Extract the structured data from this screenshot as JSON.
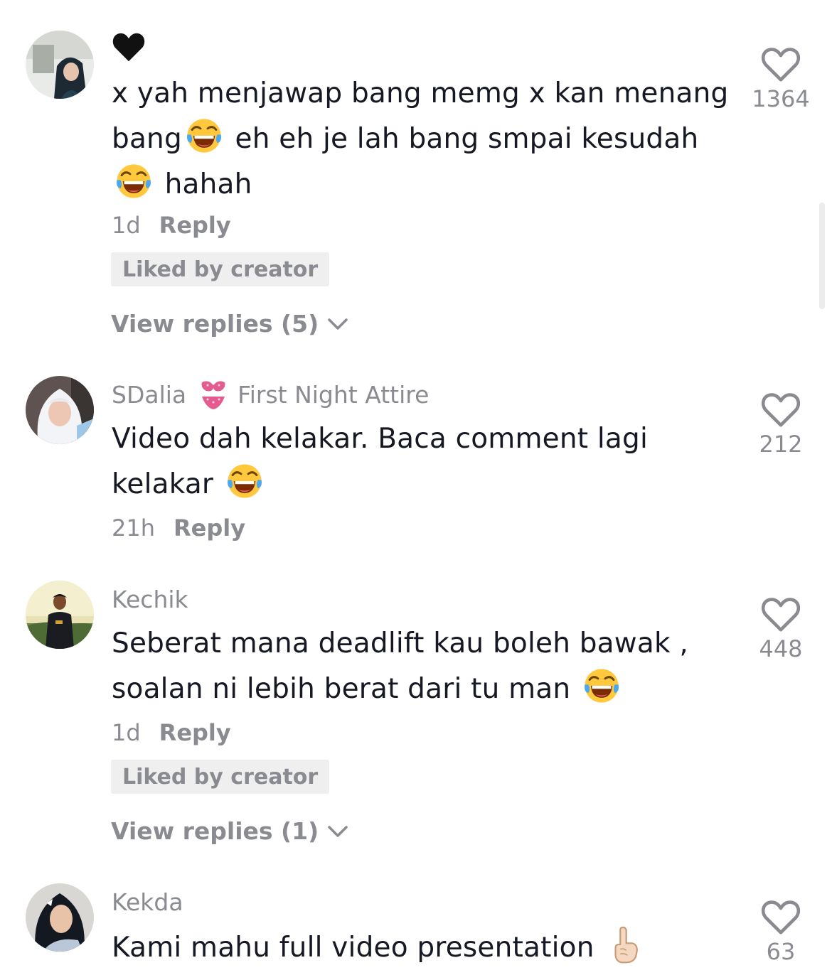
{
  "comments": [
    {
      "username": "",
      "text_parts": [
        "x yah menjawap bang memg x kan menang bang",
        "eh eh je lah bang smpai kesudah",
        "hahah"
      ],
      "time": "1d",
      "reply_label": "Reply",
      "liked_label": "Liked by creator",
      "view_replies": "View replies (5)",
      "likes": "1364",
      "avatar": "avatar-woman-hijab-car-icon"
    },
    {
      "username": "SDalia",
      "badge_icon": "bikini-emoji-icon",
      "badge_text": "First Night Attire",
      "text_parts": [
        "Video dah kelakar. Baca comment lagi kelakar"
      ],
      "time": "21h",
      "reply_label": "Reply",
      "likes": "212",
      "avatar": "avatar-woman-white-hijab-icon"
    },
    {
      "username": "Kechik",
      "text_parts": [
        "Seberat mana deadlift kau boleh bawak , soalan ni lebih berat dari tu man"
      ],
      "time": "1d",
      "reply_label": "Reply",
      "liked_label": "Liked by creator",
      "view_replies": "View replies (1)",
      "likes": "448",
      "avatar": "avatar-man-outdoors-icon"
    },
    {
      "username": "Kekda",
      "text_parts": [
        "Kami mahu full video presentation"
      ],
      "likes": "63",
      "avatar": "avatar-woman-dark-hijab-icon"
    }
  ],
  "colors": {
    "primary_text": "#161823",
    "secondary_text": "#8a8b91",
    "tag_background": "#efeff0",
    "heart_stroke": "#8a8b91"
  }
}
